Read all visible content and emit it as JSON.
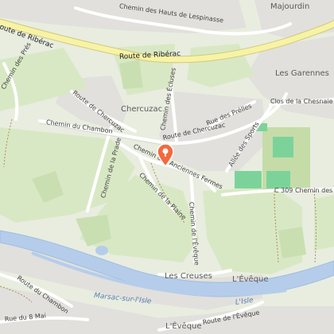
{
  "map": {
    "places": {
      "majourdin": "Majourdin",
      "les_garennes": "Les Garennes",
      "chercuzac": "Chercuzac",
      "les_creuses": "Les Creuses",
      "leveque_east": "L'Évêque",
      "leveque_south": "L'Évêque",
      "marsac_sur_lisle": "Marsac-sur-l'Isle"
    },
    "roads": {
      "ch_hauts_lespinasse": "Chemin des Hauts de Lespinasse",
      "route_riberac_west": "Route de Ribérac",
      "route_riberac_main": "Route de Ribérac",
      "ch_des_pres": "Chemin des Prés",
      "rte_chercuzac_nw": "Route de Chercuzac",
      "ch_ecluses": "Chemin des Écluses",
      "ch_chambon": "Chemin du Chambon",
      "rte_chercuzac_mid": "Route de Chercuzac",
      "rue_des_prelles": "Rue des Prélles",
      "clos_chesnaie": "Clos de la Chesnaie",
      "allee_sports": "Allée des Sports",
      "ch_anciennes_fermes": "Chemin des Anciennes Fermes",
      "ch_prade": "Chemin de la Prade",
      "ch_plaine": "Chemin de la Plaine",
      "c309": "C 309 Chemin des Ga",
      "ch_leveque": "Chemin de l'Évêque",
      "route_chambon_sw": "Route du Chambon",
      "rue_8_mai": "Rue du 8 Mai",
      "route_leveque": "Route de l'Évêque"
    },
    "water": {
      "river": "L'Isle"
    },
    "marker": {
      "icon": "location-pin-icon",
      "color": "#f26a3d"
    },
    "colors": {
      "land": "#e8ede0",
      "field": "#d9e8c4",
      "urban": "#e1e0dc",
      "sports": "#7cd39a",
      "river": "#b5cdea",
      "major_road": "#f7f3a6"
    }
  }
}
